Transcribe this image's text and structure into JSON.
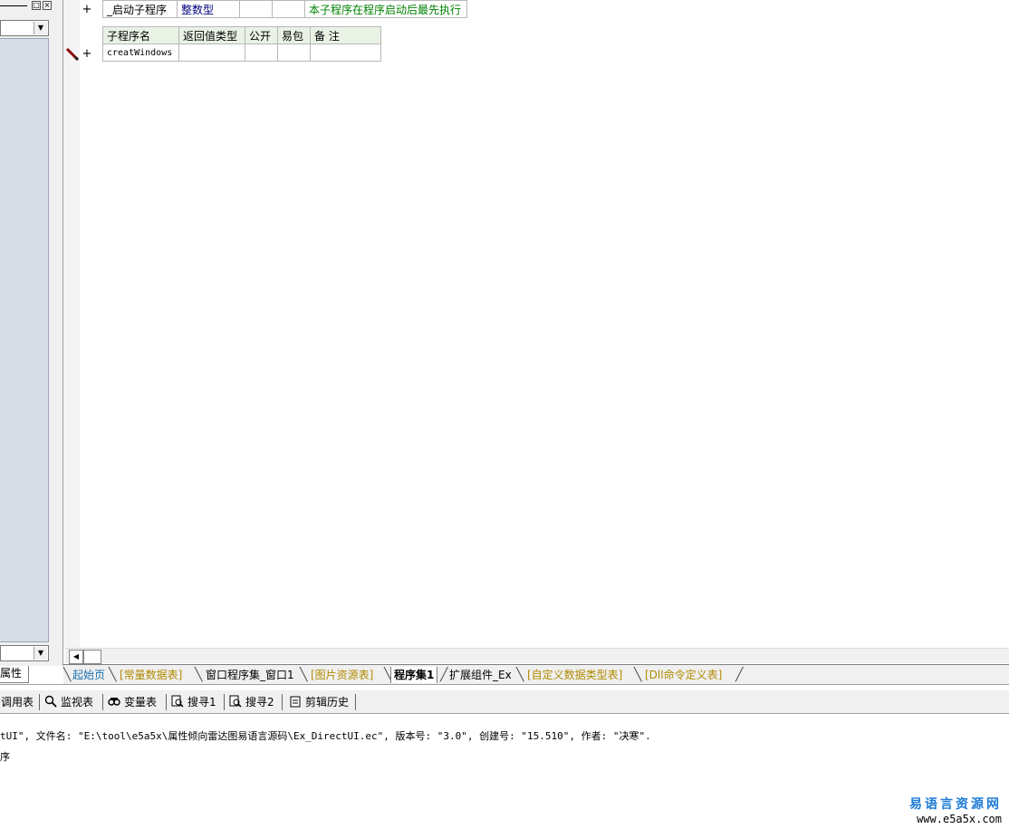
{
  "left_panel": {
    "property_tab": "属性"
  },
  "editor": {
    "row1": {
      "name": "_启动子程序",
      "type": "整数型",
      "public": "",
      "easy_pack": "",
      "remark": "本子程序在程序启动后最先执行"
    },
    "sub_table": {
      "headers": [
        "子程序名",
        "返回值类型",
        "公开",
        "易包",
        "备 注"
      ],
      "row": {
        "name": "creatWindows",
        "return_type": "",
        "public": "",
        "easy_pack": "",
        "remark": ""
      }
    }
  },
  "tabs": [
    {
      "label": "起始页"
    },
    {
      "label": "[常量数据表]"
    },
    {
      "label": "窗口程序集_窗口1"
    },
    {
      "label": "[图片资源表]"
    },
    {
      "label": "程序集1"
    },
    {
      "label": "扩展组件_Ex"
    },
    {
      "label": "[自定义数据类型表]"
    },
    {
      "label": "[Dll命令定义表]"
    }
  ],
  "toolbar": {
    "items": [
      "调用表",
      "监视表",
      "变量表",
      "搜寻1",
      "搜寻2",
      "剪辑历史"
    ]
  },
  "output": {
    "line1": "tUI\", 文件名: \"E:\\tool\\e5a5x\\属性倾向雷达图易语言源码\\Ex_DirectUI.ec\", 版本号: \"3.0\", 创建号: \"15.510\", 作者: \"决寒\".",
    "line2": "序"
  },
  "watermark": {
    "title": "易语言资源网",
    "url": "www.e5a5x.com"
  }
}
